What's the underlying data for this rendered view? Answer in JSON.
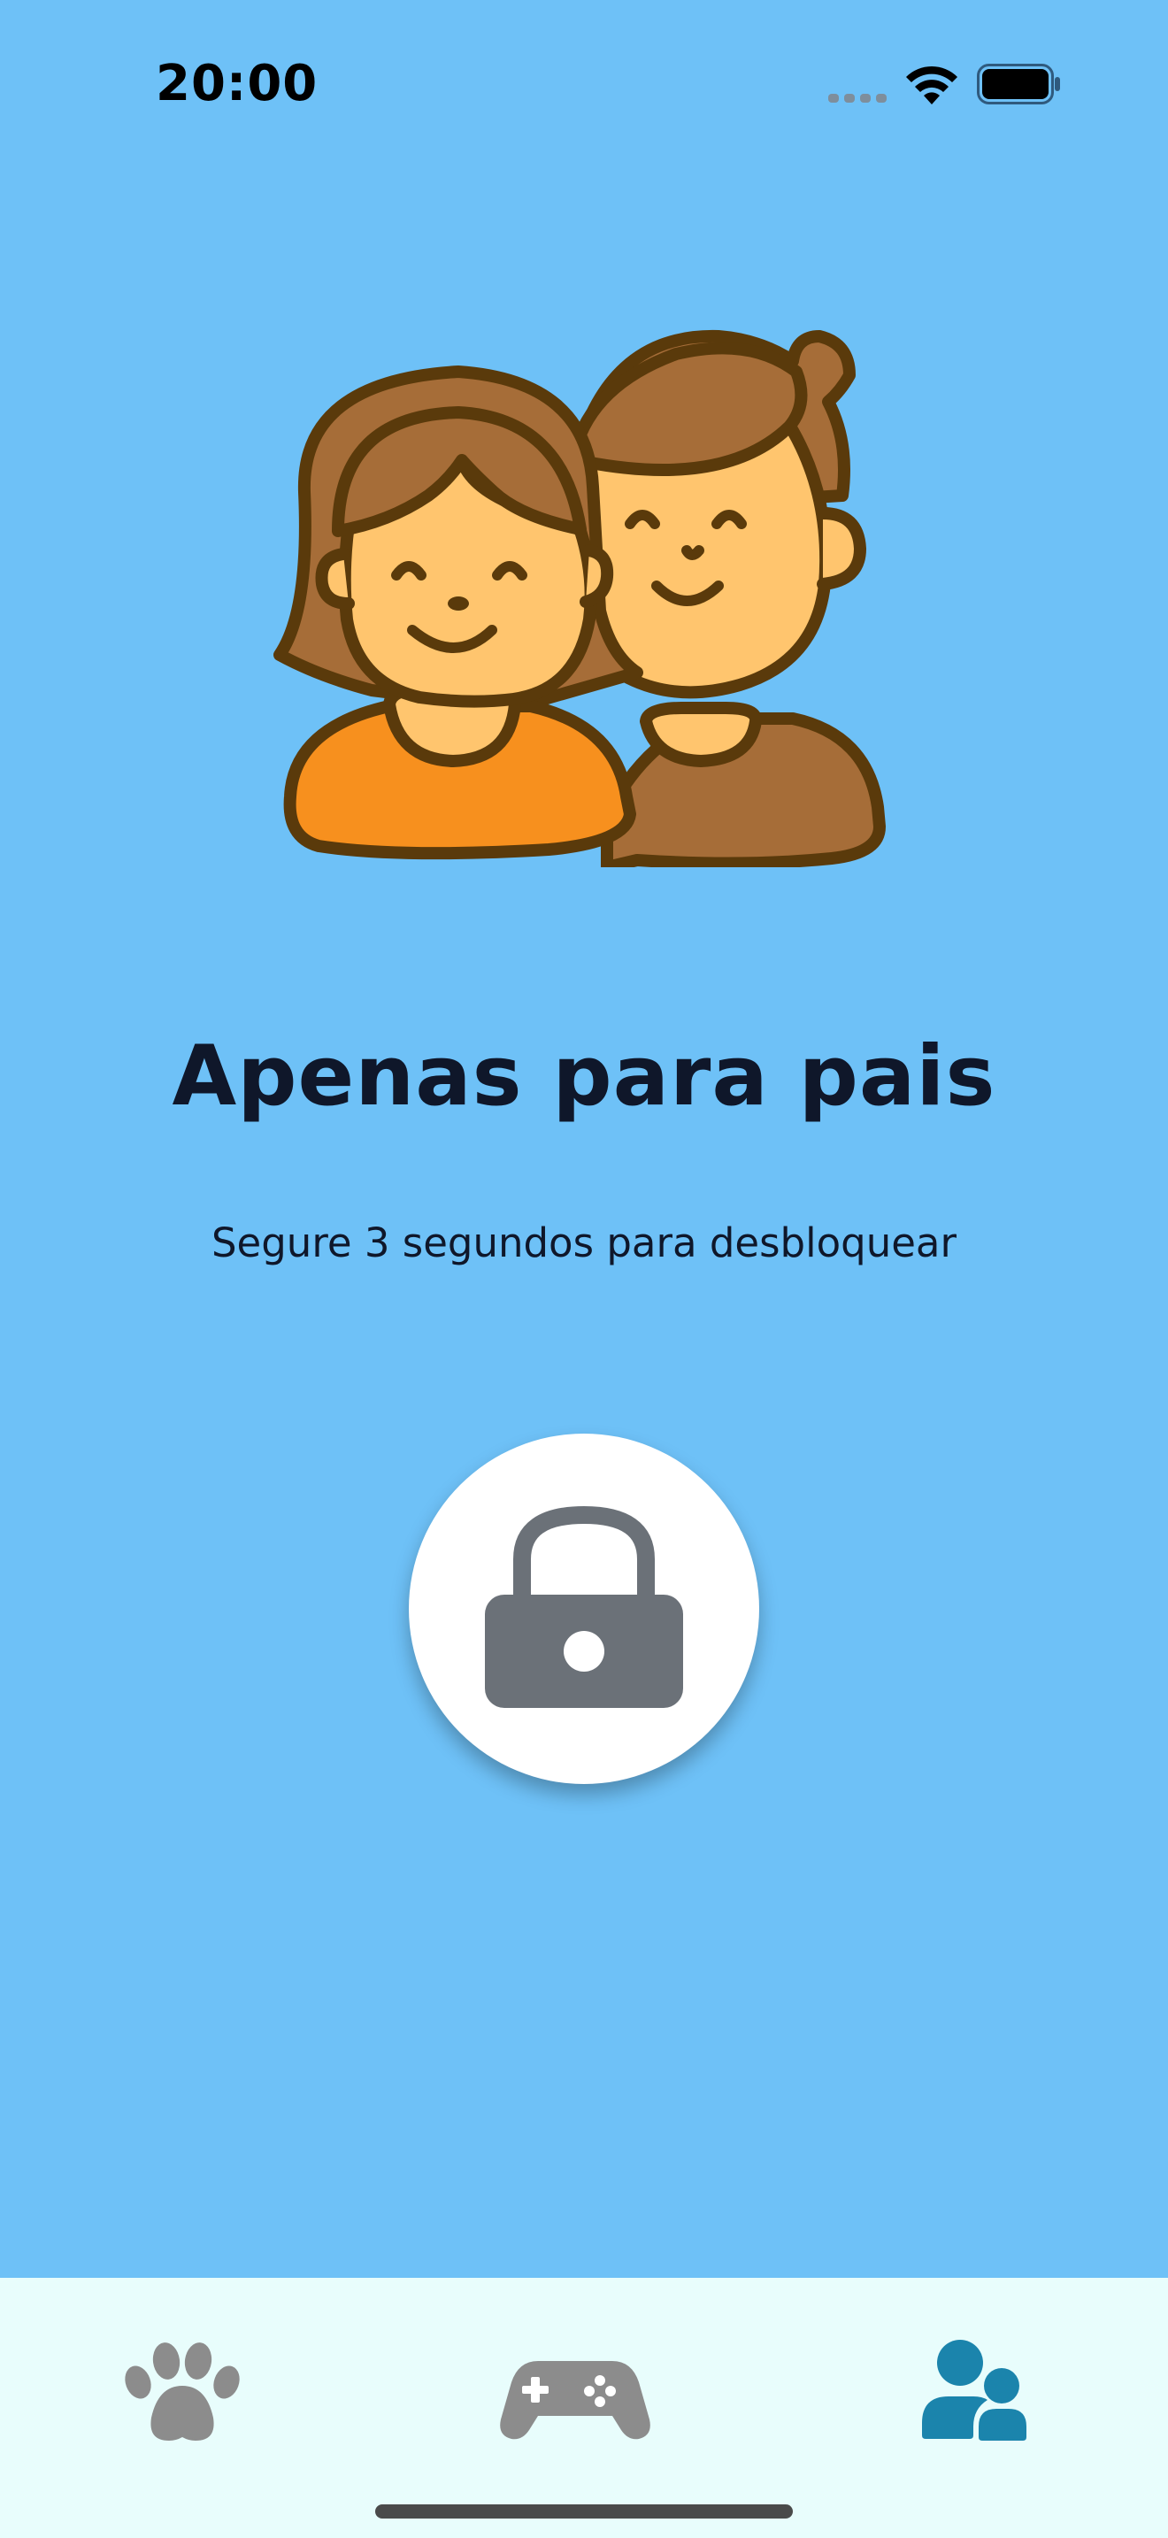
{
  "status_bar": {
    "time": "20:00"
  },
  "main": {
    "title": "Apenas para pais",
    "subtitle": "Segure 3 segundos para desbloquear",
    "illustration_icon": "parents-icon",
    "lock_icon": "lock-icon"
  },
  "tab_bar": {
    "items": [
      {
        "icon": "paw-icon",
        "selected": false
      },
      {
        "icon": "gamepad-icon",
        "selected": false
      },
      {
        "icon": "parents-icon",
        "selected": true
      }
    ]
  },
  "colors": {
    "background": "#6EC1F7",
    "tab_bar_background": "#E8FDFC",
    "tab_inactive": "#8C8C8C",
    "tab_active": "#1B84AC",
    "text": "#0F172A",
    "lock_icon": "#6B7178"
  }
}
